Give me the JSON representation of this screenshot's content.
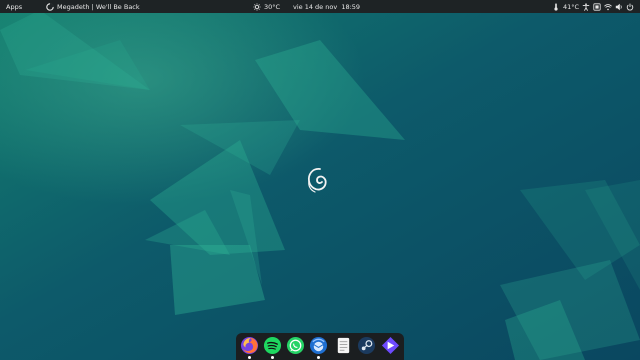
{
  "topbar": {
    "apps_label": "Apps",
    "media_title": "Megadeth | We'll Be Back",
    "weather": "30°C",
    "datetime": "vie 14 de nov  18:59",
    "cpu_temp": "41°C"
  },
  "status_icons": [
    "thermometer-icon",
    "accessibility-icon",
    "screenshot-icon",
    "wifi-icon",
    "volume-icon",
    "power-icon"
  ],
  "dock": {
    "apps": [
      {
        "name": "firefox",
        "running": true
      },
      {
        "name": "spotify",
        "running": true
      },
      {
        "name": "whatsapp",
        "running": false
      },
      {
        "name": "thunderbird",
        "running": true
      },
      {
        "name": "text-editor",
        "running": false
      },
      {
        "name": "steam",
        "running": false
      },
      {
        "name": "proton-vpn",
        "running": false
      }
    ]
  },
  "colors": {
    "wallpaper_base": "#0c4f63",
    "wallpaper_accent": "#1fa38f",
    "panel": "#1e2325",
    "dock": "#1b1e20"
  }
}
